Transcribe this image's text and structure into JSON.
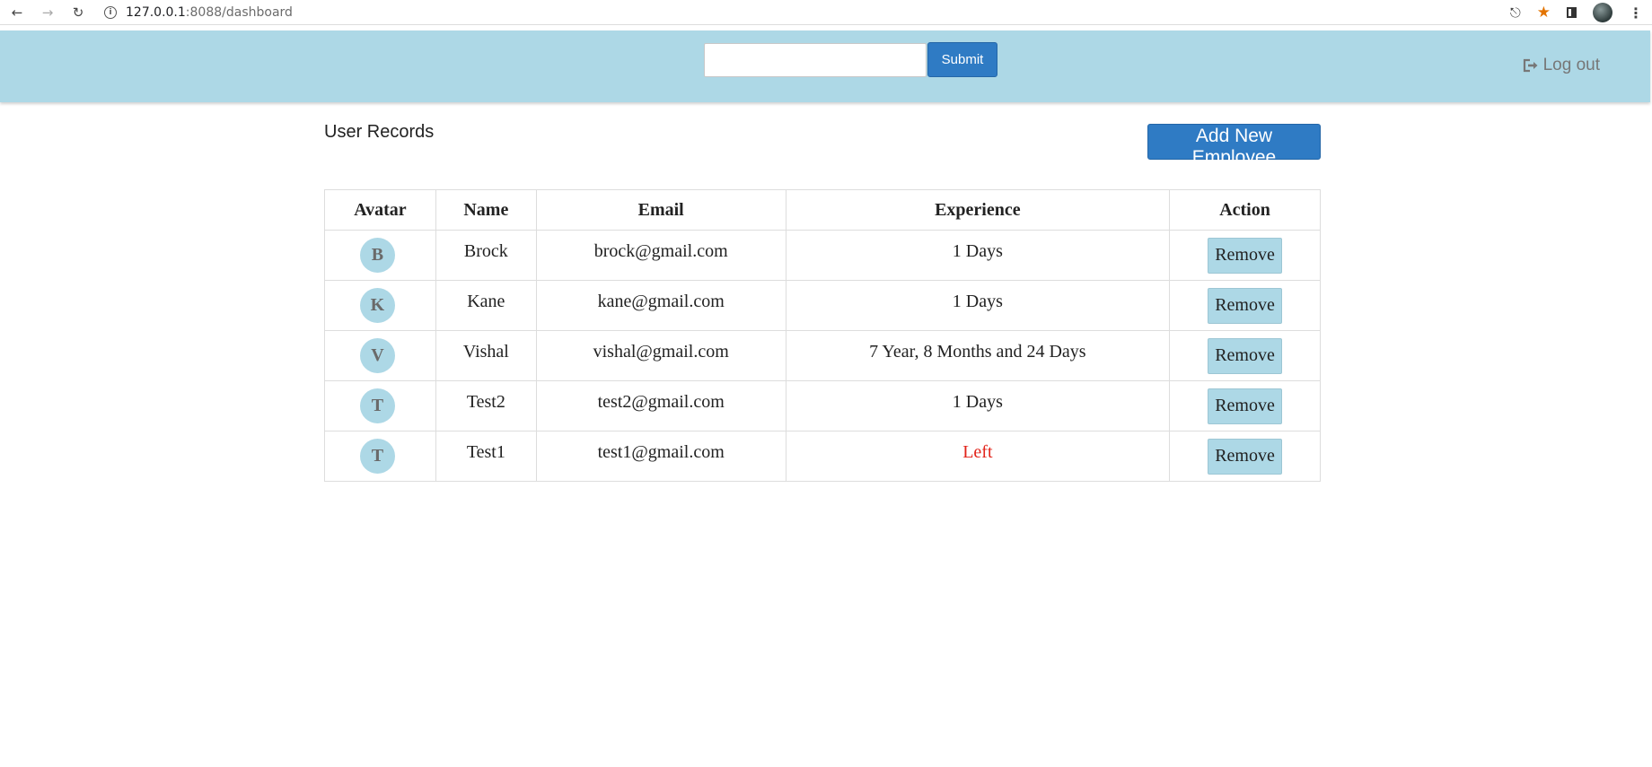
{
  "browser": {
    "url_host": "127.0.0.1",
    "url_path": ":8088/dashboard"
  },
  "header": {
    "search_value": "",
    "submit_label": "Submit",
    "logout_label": "Log out"
  },
  "main": {
    "title": "User Records",
    "add_button_label": "Add New Employee"
  },
  "table": {
    "headers": [
      "Avatar",
      "Name",
      "Email",
      "Experience",
      "Action"
    ],
    "rows": [
      {
        "initial": "B",
        "name": "Brock",
        "email": "brock@gmail.com",
        "experience": "1 Days",
        "action": "Remove"
      },
      {
        "initial": "K",
        "name": "Kane",
        "email": "kane@gmail.com",
        "experience": "1 Days",
        "action": "Remove"
      },
      {
        "initial": "V",
        "name": "Vishal",
        "email": "vishal@gmail.com",
        "experience": "7 Year, 8 Months and 24 Days",
        "action": "Remove"
      },
      {
        "initial": "T",
        "name": "Test2",
        "email": "test2@gmail.com",
        "experience": "1 Days",
        "action": "Remove"
      },
      {
        "initial": "T",
        "name": "Test1",
        "email": "test1@gmail.com",
        "experience": "Left",
        "action": "Remove"
      }
    ]
  },
  "colors": {
    "header_bg": "#add8e6",
    "primary_button": "#2f7bc4",
    "left_status": "#e2231a"
  }
}
